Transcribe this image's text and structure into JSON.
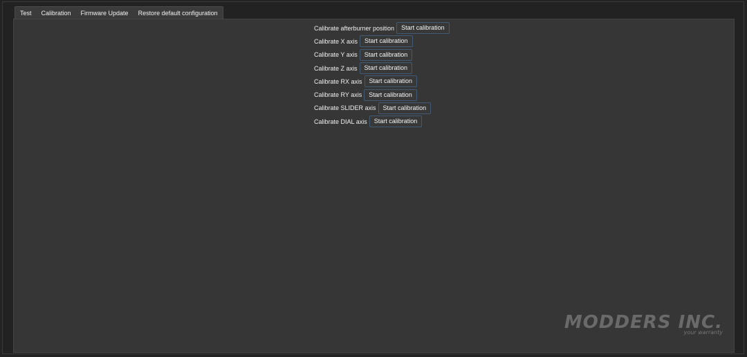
{
  "tabs": [
    "Test",
    "Calibration",
    "Firmware Update",
    "Restore default configuration"
  ],
  "calibration": {
    "button_label": "Start calibration",
    "rows": [
      "Calibrate afterburner position",
      "Calibrate X axis",
      "Calibrate Y axis",
      "Calibrate Z axis",
      "Calibrate RX axis",
      "Calibrate RY axis",
      "Calibrate SLIDER axis",
      "Calibrate DIAL axis"
    ]
  },
  "watermark": {
    "brand": "MODDERS INC.",
    "tagline_accent": "",
    "tagline": "your warranty"
  },
  "colors": {
    "background": "#232323",
    "panel": "#363636",
    "button_border": "#425a74",
    "text": "#f0f0f0"
  }
}
